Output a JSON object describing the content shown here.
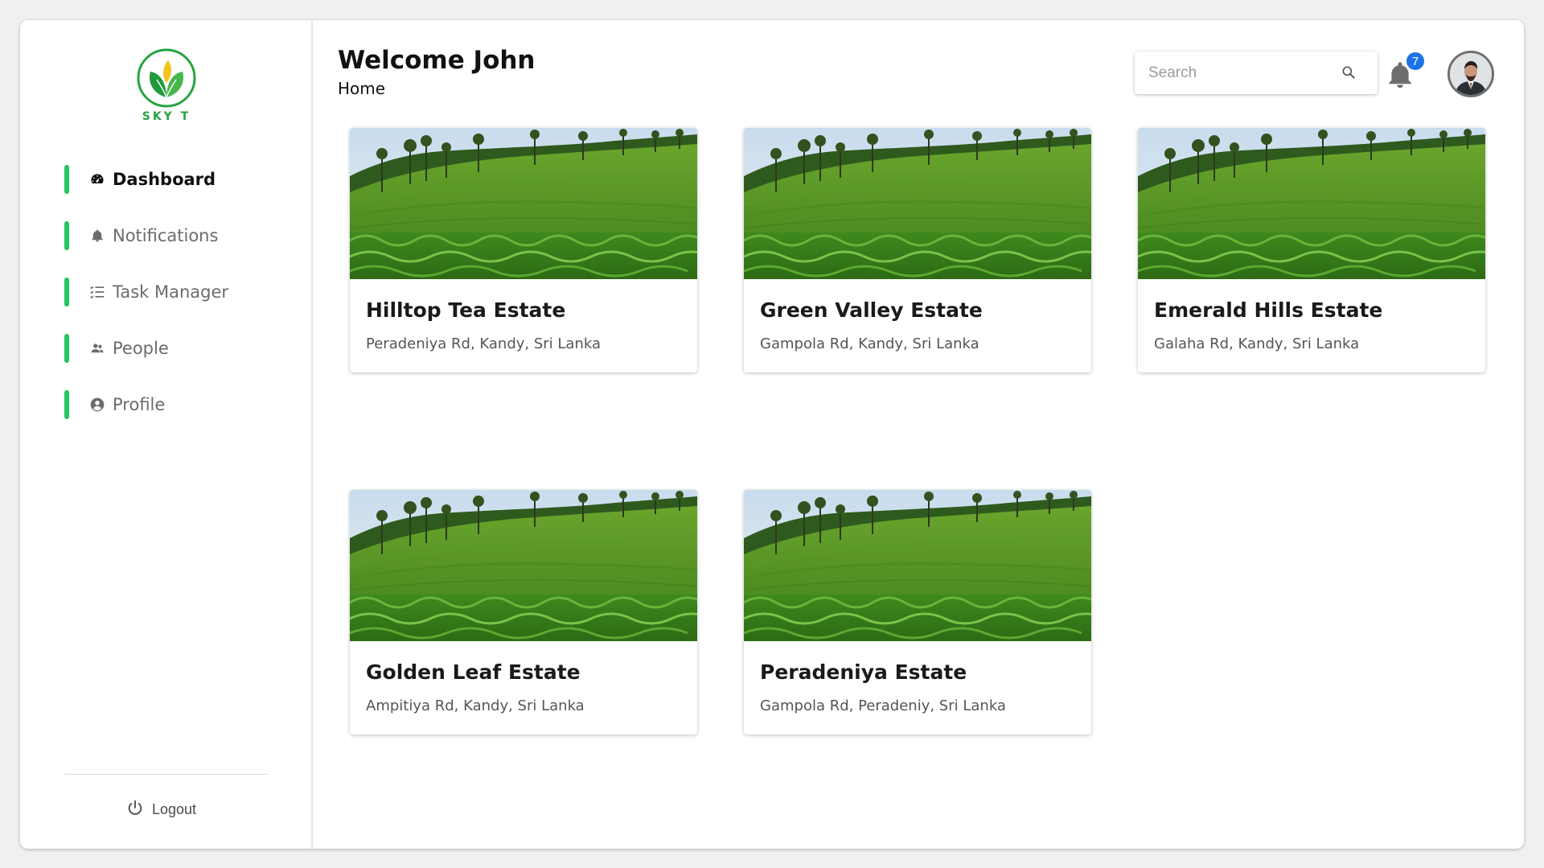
{
  "brand": {
    "name": "SKY T"
  },
  "sidebar": {
    "items": [
      {
        "label": "Dashboard",
        "icon": "dashboard-icon",
        "active": true
      },
      {
        "label": "Notifications",
        "icon": "bell-icon",
        "active": false
      },
      {
        "label": "Task Manager",
        "icon": "checklist-icon",
        "active": false
      },
      {
        "label": "People",
        "icon": "people-icon",
        "active": false
      },
      {
        "label": "Profile",
        "icon": "user-circle-icon",
        "active": false
      }
    ],
    "logout": "Logout"
  },
  "header": {
    "welcome": "Welcome John",
    "breadcrumb": "Home",
    "search_placeholder": "Search",
    "notification_count": "7"
  },
  "estates": [
    {
      "name": "Hilltop Tea Estate",
      "address": "Peradeniya Rd, Kandy, Sri Lanka"
    },
    {
      "name": "Green Valley Estate",
      "address": "Gampola Rd, Kandy, Sri Lanka"
    },
    {
      "name": "Emerald Hills Estate",
      "address": "Galaha Rd, Kandy, Sri Lanka"
    },
    {
      "name": "Golden Leaf Estate",
      "address": "Ampitiya Rd, Kandy, Sri Lanka"
    },
    {
      "name": "Peradeniya Estate",
      "address": "Gampola Rd, Peradeniy, Sri Lanka"
    }
  ],
  "colors": {
    "accent": "#22c55e",
    "brand_green": "#27a33f",
    "badge_blue": "#1a73e8"
  }
}
